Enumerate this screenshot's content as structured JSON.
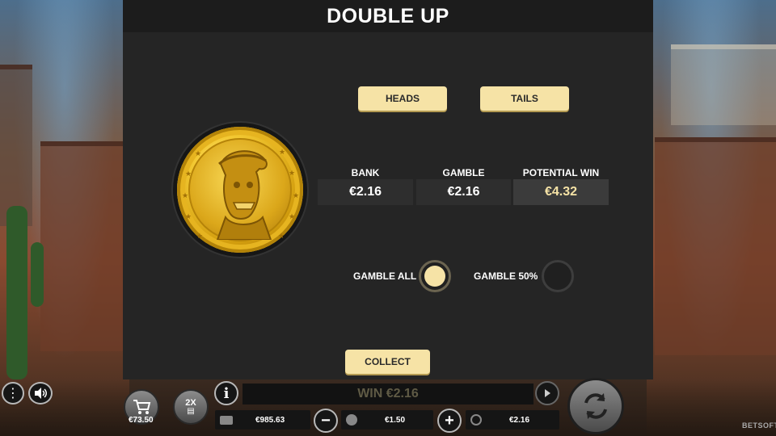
{
  "title": "DOUBLE UP",
  "choices": {
    "heads": "HEADS",
    "tails": "TAILS"
  },
  "stats": {
    "bank_label": "BANK",
    "bank_value": "€2.16",
    "gamble_label": "GAMBLE",
    "gamble_value": "€2.16",
    "potential_label": "POTENTIAL WIN",
    "potential_value": "€4.32"
  },
  "gamble_options": {
    "all_label": "GAMBLE ALL",
    "all_selected": true,
    "half_label": "GAMBLE 50%",
    "half_selected": false
  },
  "collect_label": "COLLECT",
  "hud": {
    "buy_value": "€73.50",
    "multiplier_label": "2X",
    "win_text": "WIN €2.16",
    "balance": "€985.63",
    "bet": "€1.50",
    "last_win": "€2.16",
    "brand": "BETSOFT"
  },
  "colors": {
    "accent": "#f6e3a6",
    "panel": "#252525",
    "title_bar": "#1c1c1c"
  }
}
